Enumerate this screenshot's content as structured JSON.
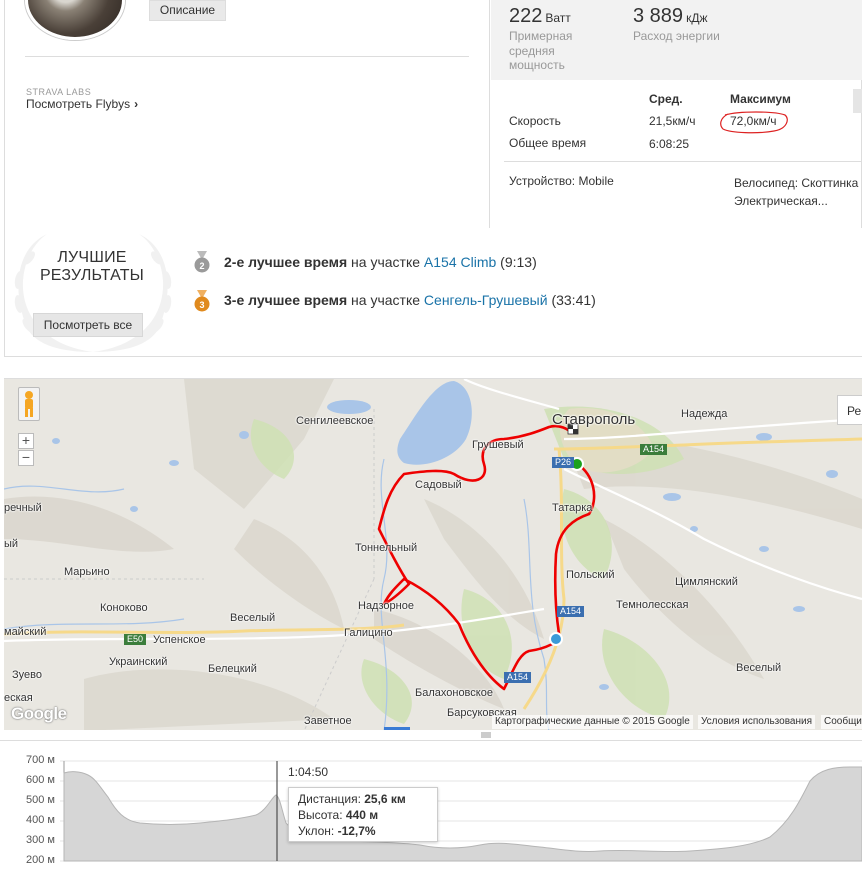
{
  "profile": {
    "description_button": "Описание",
    "labs_label": "STRAVA LABS",
    "flyby_link": "Посмотреть Flybys",
    "flyby_chevron": "›"
  },
  "stats": {
    "power_value": "222",
    "power_unit": "Ватт",
    "power_label_lines": [
      "Примерная",
      "средняя",
      "мощность"
    ],
    "energy_value": "3 889",
    "energy_unit": "кДж",
    "energy_label": "Расход энергии",
    "col_avg": "Сред.",
    "col_max": "Максимум",
    "rows": [
      {
        "label": "Скорость",
        "avg": "21,5км/ч",
        "max": "72,0км/ч"
      },
      {
        "label": "Общее время",
        "avg": "6:08:25",
        "max": ""
      }
    ],
    "device": "Устройство: Mobile",
    "bike_lines": [
      "Велосипед: Скоттинка",
      "Электрическая..."
    ]
  },
  "achievements": {
    "title_lines": [
      "ЛУЧШИЕ",
      "РЕЗУЛЬТАТЫ"
    ],
    "see_all": "Посмотреть все",
    "items": [
      {
        "rank": "2",
        "prefix": "2-е лучшее время",
        "mid": " на участке ",
        "segment": "A154 Climb",
        "time": " (9:13)",
        "color": "#9a9a9a"
      },
      {
        "rank": "3",
        "prefix": "3-е лучшее время",
        "mid": " на участке ",
        "segment": "Сенгель-Грушевый",
        "time": " (33:41)",
        "color": "#e08a1e"
      }
    ]
  },
  "map": {
    "labels": {
      "stavropol": "Ставрополь",
      "nadezhda": "Надежда",
      "sengileevskoe": "Сенгилеевское",
      "grushevy": "Грушевый",
      "sadovy": "Садовый",
      "tatarka": "Татарка",
      "tonnelny": "Тоннельный",
      "polsky": "Польский",
      "tsimlyansky": "Цимлянский",
      "marino": "Марьино",
      "konokovo": "Коноково",
      "vesely1": "Веселый",
      "nadzornoe": "Надзорное",
      "temnolesskaya": "Темнолесская",
      "uspenskoe": "Успенское",
      "galitsino": "Галицино",
      "ukrainsky": "Украинский",
      "beletsky": "Белецкий",
      "vesely2": "Веселый",
      "zuevo": "Зуево",
      "balakhonovskoe": "Балахоновское",
      "barsukovskaya": "Барсуковская",
      "zavetnoe": "Заветное",
      "rechny": "речный",
      "maisky": "майский",
      "vyi": "вый",
      "bl": "ый",
      "eskaya": "еская"
    },
    "road_signs": [
      "A154",
      "P26",
      "A154",
      "A154",
      "E50"
    ],
    "zoom_in": "+",
    "zoom_out": "−",
    "maptype_label": "Ре",
    "google_logo": "Google",
    "attribution": "Картографические данные © 2015 Google",
    "terms": "Условия использования",
    "report": "Сообщи"
  },
  "elevation": {
    "y_ticks": [
      "700 м",
      "600 м",
      "500 м",
      "400 м",
      "300 м",
      "200 м"
    ],
    "cursor_time": "1:04:50",
    "tooltip": {
      "distance_label": "Дистанция: ",
      "distance_value": "25,6 км",
      "height_label": "Высота: ",
      "height_value": "440 м",
      "grade_label": "Уклон: ",
      "grade_value": "-12,7%"
    }
  }
}
